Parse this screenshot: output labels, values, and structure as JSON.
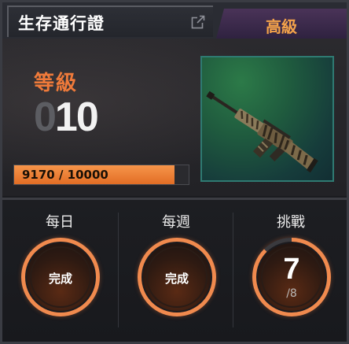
{
  "header": {
    "title": "生存通行證",
    "tier": "高級",
    "open_icon": "external-link-icon"
  },
  "level": {
    "label": "等級",
    "prefix": "0",
    "value": "10"
  },
  "xp": {
    "text": "9170 / 10000",
    "current": 9170,
    "max": 10000
  },
  "reward": {
    "icon": "assault-rifle-skin-icon"
  },
  "challenges": {
    "daily": {
      "label": "每日",
      "status": "完成"
    },
    "weekly": {
      "label": "每週",
      "status": "完成"
    },
    "challenge": {
      "label": "挑戰",
      "completed": "7",
      "total": "/8",
      "progress": 0.875
    }
  },
  "colors": {
    "accent_orange": "#ef7a3a",
    "tier_text": "#f3a24a",
    "tier_bg": "#3e2b4d",
    "weapon_frame": "#2f7a72"
  }
}
